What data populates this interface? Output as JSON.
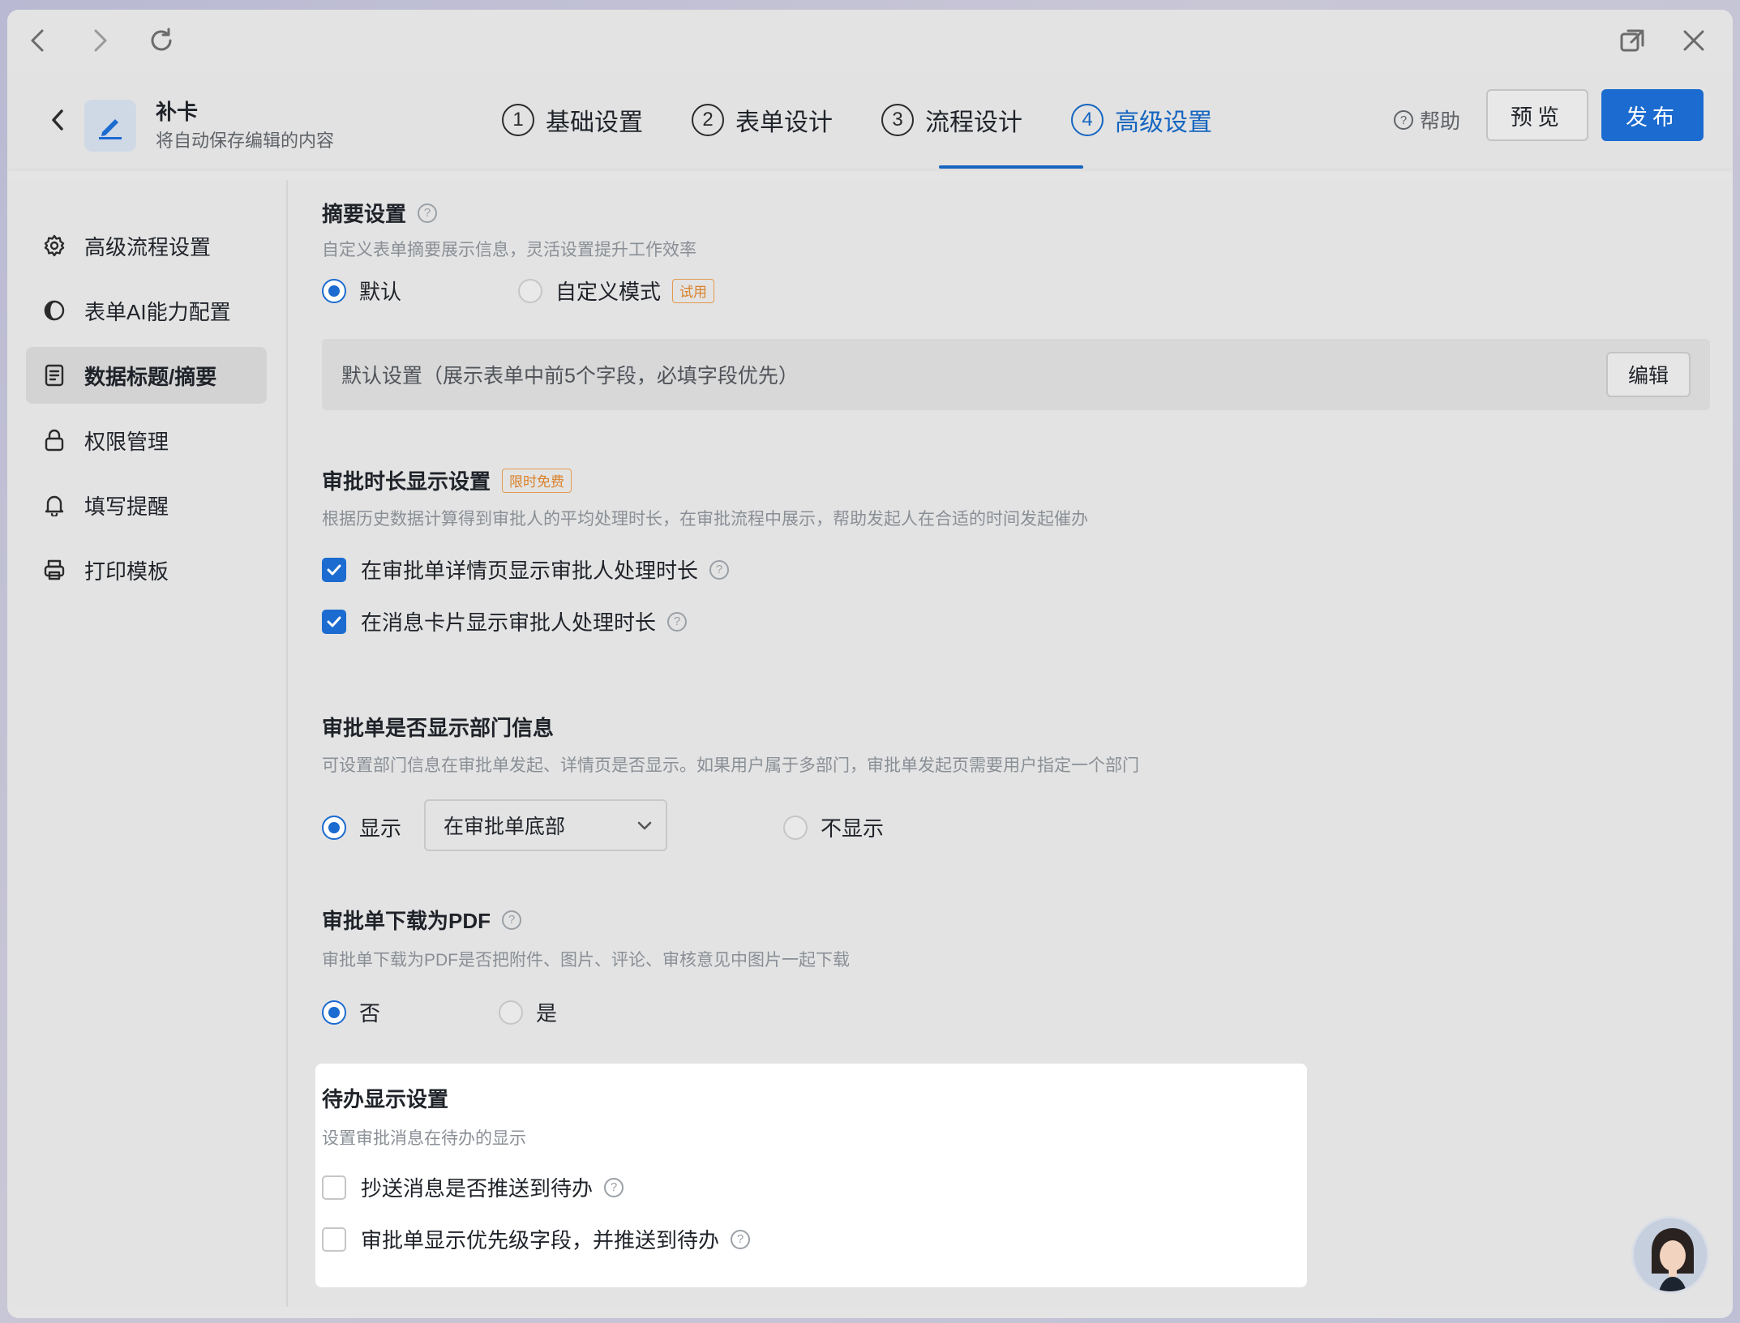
{
  "header": {
    "form_name": "补卡",
    "subtitle": "将自动保存编辑的内容",
    "steps": [
      {
        "num": "1",
        "label": "基础设置"
      },
      {
        "num": "2",
        "label": "表单设计"
      },
      {
        "num": "3",
        "label": "流程设计"
      },
      {
        "num": "4",
        "label": "高级设置"
      }
    ],
    "active_step": 4,
    "help_label": "帮助",
    "preview_label": "预览",
    "publish_label": "发布"
  },
  "sidebar": {
    "items": [
      {
        "label": "高级流程设置",
        "icon": "gear-icon"
      },
      {
        "label": "表单AI能力配置",
        "icon": "ai-icon"
      },
      {
        "label": "数据标题/摘要",
        "icon": "document-icon",
        "active": true
      },
      {
        "label": "权限管理",
        "icon": "lock-icon"
      },
      {
        "label": "填写提醒",
        "icon": "bell-icon"
      },
      {
        "label": "打印模板",
        "icon": "printer-icon"
      }
    ]
  },
  "summary": {
    "title": "摘要设置",
    "desc": "自定义表单摘要展示信息，灵活设置提升工作效率",
    "opt_default": "默认",
    "opt_custom": "自定义模式",
    "custom_tag": "试用",
    "selected": "默认",
    "default_text": "默认设置（展示表单中前5个字段，必填字段优先）",
    "edit_label": "编辑"
  },
  "duration": {
    "title": "审批时长显示设置",
    "tag": "限时免费",
    "desc": "根据历史数据计算得到审批人的平均处理时长，在审批流程中展示，帮助发起人在合适的时间发起催办",
    "check1": "在审批单详情页显示审批人处理时长",
    "check1_on": true,
    "check2": "在消息卡片显示审批人处理时长",
    "check2_on": true
  },
  "dept": {
    "title": "审批单是否显示部门信息",
    "desc": "可设置部门信息在审批单发起、详情页是否显示。如果用户属于多部门，审批单发起页需要用户指定一个部门",
    "opt_show": "显示",
    "select_value": "在审批单底部",
    "opt_hide": "不显示",
    "selected": "显示"
  },
  "pdf": {
    "title": "审批单下载为PDF",
    "desc": "审批单下载为PDF是否把附件、图片、评论、审核意见中图片一起下载",
    "opt_no": "否",
    "opt_yes": "是",
    "selected": "否"
  },
  "todo": {
    "title": "待办显示设置",
    "desc": "设置审批消息在待办的显示",
    "check1": "抄送消息是否推送到待办",
    "check1_on": false,
    "check2": "审批单显示优先级字段，并推送到待办",
    "check2_on": false
  },
  "colors": {
    "accent": "#1b6bd0",
    "tag_orange": "#d9822b"
  }
}
